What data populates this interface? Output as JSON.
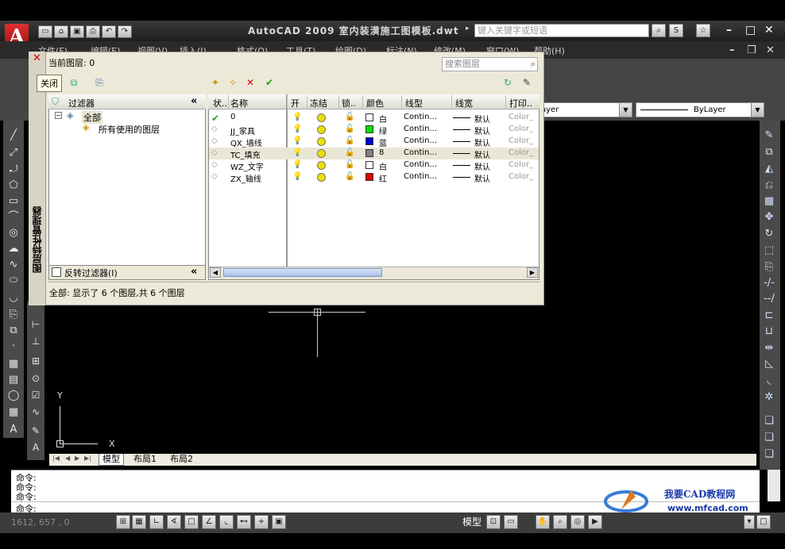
{
  "app": {
    "title": "AutoCAD 2009  室内装潢施工图模板.dwt",
    "search_placeholder": "键入关键字或短语",
    "logo_letter": "A"
  },
  "menu": {
    "items": [
      "文件(F)",
      "编辑(E)",
      "视图(V)",
      "插入(I)",
      "格式(O)",
      "工具(T)",
      "绘图(D)",
      "标注(N)",
      "修改(M)",
      "窗口(W)",
      "帮助(H)"
    ]
  },
  "toolbar": {
    "layer_dropdown": "ayer",
    "linetype_dropdown": "ByLayer"
  },
  "layer_manager": {
    "vertical_title": "图层特性管理器",
    "current_layer": "当前图层: 0",
    "search_placeholder": "搜索图层",
    "tooltip": "关闭",
    "filters_header": "过滤器",
    "tree": {
      "all": "全部",
      "used": "所有使用的图层"
    },
    "invert_filter": "反转过滤器(I)",
    "columns": [
      "状..",
      "名称",
      "开",
      "冻结",
      "锁..",
      "颜色",
      "线型",
      "线宽",
      "打印.."
    ],
    "layers": [
      {
        "name": "0",
        "color_name": "白",
        "color": "#ffffff",
        "linetype": "Contin...",
        "lineweight": "默认",
        "plot": "Color_",
        "current": true,
        "selected": false
      },
      {
        "name": "JJ_家具",
        "color_name": "绿",
        "color": "#00e000",
        "linetype": "Contin...",
        "lineweight": "默认",
        "plot": "Color_",
        "current": false,
        "selected": false
      },
      {
        "name": "QX_墙线",
        "color_name": "蓝",
        "color": "#0000d0",
        "linetype": "Contin...",
        "lineweight": "默认",
        "plot": "Color_",
        "current": false,
        "selected": false
      },
      {
        "name": "TC_填充",
        "color_name": "8",
        "color": "#808080",
        "linetype": "Contin...",
        "lineweight": "默认",
        "plot": "Color_",
        "current": false,
        "selected": true
      },
      {
        "name": "WZ_文字",
        "color_name": "白",
        "color": "#ffffff",
        "linetype": "Contin...",
        "lineweight": "默认",
        "plot": "Color_",
        "current": false,
        "selected": false
      },
      {
        "name": "ZX_轴线",
        "color_name": "红",
        "color": "#e00000",
        "linetype": "Contin...",
        "lineweight": "默认",
        "plot": "Color_",
        "current": false,
        "selected": false
      }
    ],
    "status": "全部: 显示了 6 个图层,共 6 个图层"
  },
  "canvas": {
    "ucs_x": "X",
    "ucs_y": "Y"
  },
  "tabs": [
    "模型",
    "布局1",
    "布局2"
  ],
  "command": {
    "lines": [
      "命令:",
      "命令:",
      "命令:"
    ],
    "prompt": "命令:"
  },
  "statusbar": {
    "coords": "1612, 657 , 0",
    "model_label": "模型"
  },
  "watermark": {
    "title": "我要CAD教程网",
    "url": "www.mfcad.com"
  }
}
